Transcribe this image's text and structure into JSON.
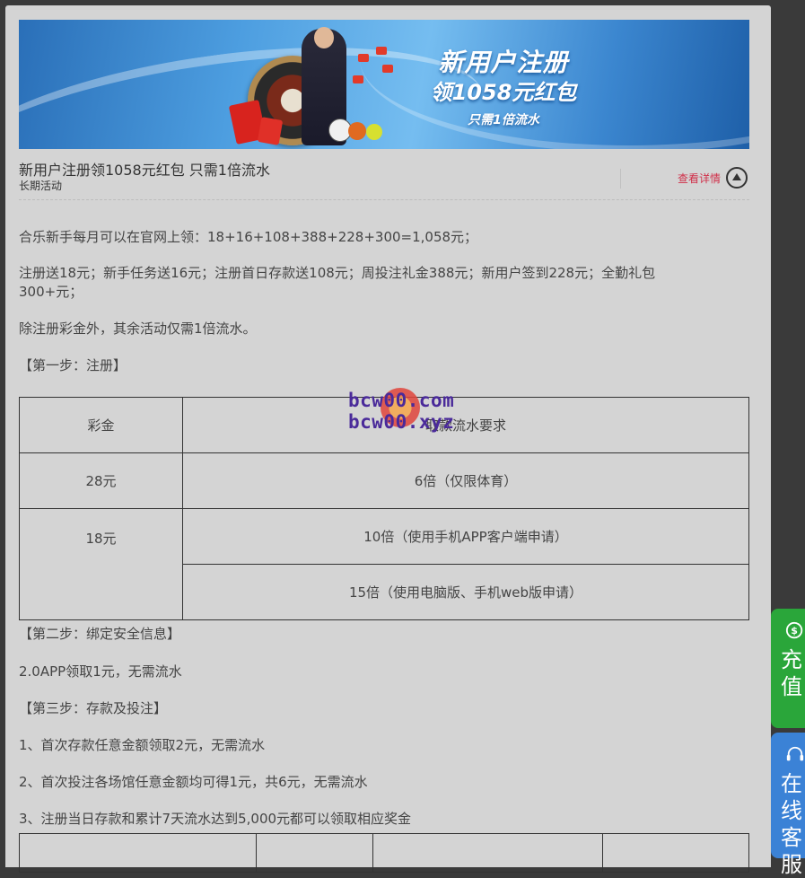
{
  "banner": {
    "line1": "新用户注册",
    "line2": "领1058元红包",
    "line3": "只需1倍流水"
  },
  "promo": {
    "title": "新用户注册领1058元红包 只需1倍流水",
    "subtitle": "长期活动",
    "detail_link": "查看详情"
  },
  "content": {
    "p1": "合乐新手每月可以在官网上领：18+16+108+388+228+300=1,058元；",
    "p2": "注册送18元；新手任务送16元；注册首日存款送108元；周投注礼金388元；新用户签到228元；全勤礼包300+元；",
    "p3": "除注册彩金外，其余活动仅需1倍流水。",
    "step1": "【第一步：注册】",
    "step2": "【第二步：绑定安全信息】",
    "p4": "2.0APP领取1元，无需流水",
    "step3": "【第三步：存款及投注】",
    "p5": "1、首次存款任意金额领取2元，无需流水",
    "p6": "2、首次投注各场馆任意金额均可得1元，共6元，无需流水",
    "p7": "3、注册当日存款和累计7天流水达到5,000元都可以领取相应奖金"
  },
  "table": {
    "header": [
      "彩金",
      "取款流水要求"
    ],
    "row1": [
      "28元",
      "6倍（仅限体育）"
    ],
    "row2_amount": "18元",
    "row2_a": "10倍（使用手机APP客户端申请）",
    "row2_b": "15倍（使用电脑版、手机web版申请）"
  },
  "watermark": {
    "line1": "bcw00.com",
    "line2": "bcw00.xyz"
  },
  "side": {
    "deposit_label": "充值",
    "support_label": "在线客服"
  },
  "colors": {
    "panel_bg": "#d4d4d4",
    "link_red": "#d0304a",
    "deposit_green": "#2aa63a",
    "support_blue": "#3b82d6"
  }
}
